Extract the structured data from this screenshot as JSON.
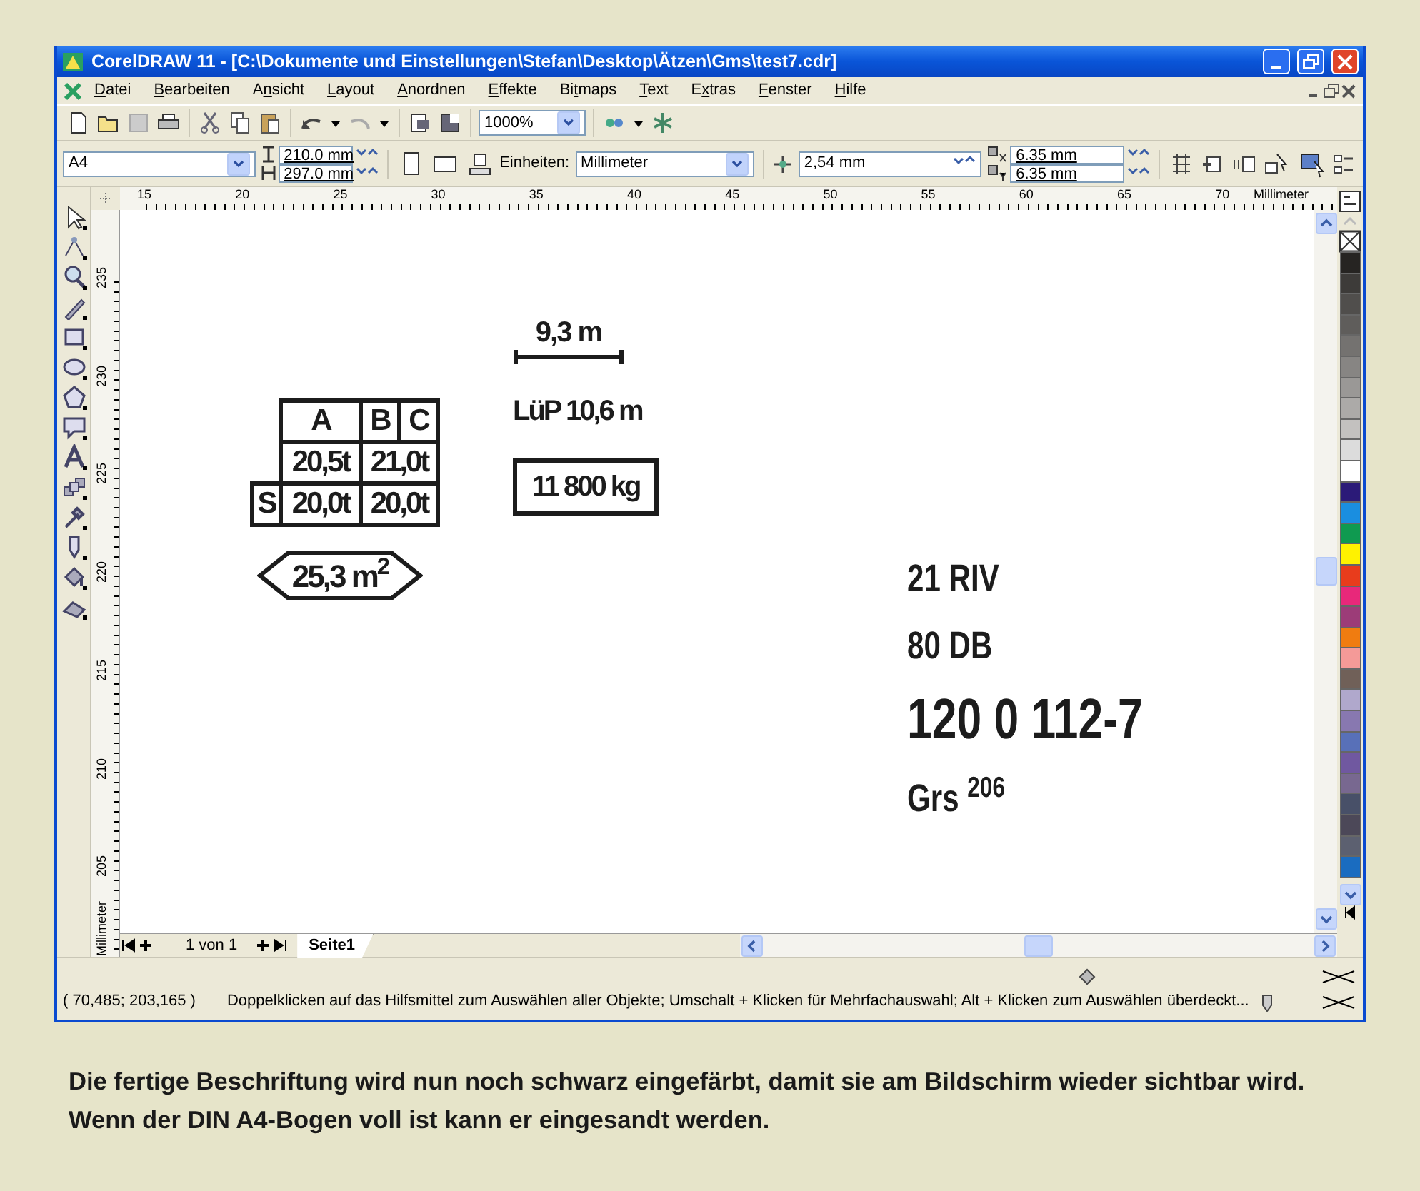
{
  "window": {
    "title": "CorelDRAW 11 - [C:\\Dokumente und Einstellungen\\Stefan\\Desktop\\Ätzen\\Gms\\test7.cdr]"
  },
  "menu": [
    {
      "key": "D",
      "post": "atei"
    },
    {
      "key": "B",
      "post": "earbeiten"
    },
    {
      "pre": "A",
      "key": "n",
      "post": "sicht"
    },
    {
      "key": "L",
      "post": "ayout"
    },
    {
      "key": "A",
      "post": "nordnen"
    },
    {
      "key": "E",
      "post": "ffekte"
    },
    {
      "pre": "Bi",
      "key": "t",
      "post": "maps"
    },
    {
      "key": "T",
      "post": "ext"
    },
    {
      "pre": "E",
      "key": "x",
      "post": "tras"
    },
    {
      "key": "F",
      "post": "enster"
    },
    {
      "key": "H",
      "post": "ilfe"
    }
  ],
  "toolbar": {
    "zoom": "1000%"
  },
  "property_bar": {
    "page_size": "A4",
    "width": "210.0 mm",
    "height": "297.0 mm",
    "units_label": "Einheiten:",
    "units": "Millimeter",
    "nudge": "2,54 mm",
    "duplicate_x": "6.35 mm",
    "duplicate_y": "6.35 mm"
  },
  "rulers": {
    "horizontal": [
      "15",
      "20",
      "25",
      "30",
      "35",
      "40",
      "45",
      "50",
      "55",
      "60",
      "65",
      "70"
    ],
    "horizontal_unit": "Millimeter",
    "vertical": [
      "235",
      "230",
      "225",
      "220",
      "215",
      "210",
      "205"
    ],
    "vertical_unit": "Millimeter"
  },
  "drawing": {
    "weight_table": {
      "columns": [
        "A",
        "B",
        "C"
      ],
      "rows": [
        {
          "cells": [
            {
              "text": "20,5t"
            },
            {
              "text": "21,0t",
              "colspan": 2
            }
          ]
        },
        {
          "label": "S",
          "cells": [
            {
              "text": "20,0t"
            },
            {
              "text": "20,0t",
              "colspan": 2
            }
          ]
        }
      ]
    },
    "area_sign": "25,3 m$^{2}$",
    "length_marker": "9,3 m",
    "overall_length": "LüP 10,6 m",
    "tare_box": "11 800 kg",
    "markings": [
      {
        "text": "21 RIV",
        "kind": "medium"
      },
      {
        "text": "80 DB",
        "kind": "medium"
      },
      {
        "text": "120 0 112-7",
        "kind": "large"
      },
      {
        "text": "Grs $^{206}$",
        "kind": "medium"
      }
    ]
  },
  "palette": [
    {
      "color": "#262422"
    },
    {
      "color": "#3d3b39"
    },
    {
      "color": "#504e4c"
    },
    {
      "color": "#5f5d5b"
    },
    {
      "color": "#747270"
    },
    {
      "color": "#878583"
    },
    {
      "color": "#9a9896"
    },
    {
      "color": "#acaaa8"
    },
    {
      "color": "#c3c1bf"
    },
    {
      "color": "#dcdcdc"
    },
    {
      "color": "#ffffff"
    },
    {
      "color": "#2b1a78"
    },
    {
      "color": "#1a8ee0"
    },
    {
      "color": "#0f9a50"
    },
    {
      "color": "#fff200"
    },
    {
      "color": "#e83c1c"
    },
    {
      "color": "#e8287a"
    },
    {
      "color": "#9c3c78"
    },
    {
      "color": "#f07c10"
    },
    {
      "color": "#f49a98"
    },
    {
      "color": "#706058"
    },
    {
      "color": "#b0a8cc"
    },
    {
      "color": "#8878b0"
    },
    {
      "color": "#5870b8"
    },
    {
      "color": "#7058a0"
    },
    {
      "color": "#786890"
    },
    {
      "color": "#485068"
    },
    {
      "color": "#4c4858"
    },
    {
      "color": "#5c6070"
    },
    {
      "color": "#1a6cc0"
    }
  ],
  "page_tabs": {
    "counter": "1 von 1",
    "tabs": [
      {
        "label": "Seite1",
        "selected": true
      }
    ]
  },
  "status_bar": {
    "coordinates": "( 70,485; 203,165 )",
    "hint": "Doppelklicken auf das Hilfsmittel zum Auswählen aller Objekte; Umschalt + Klicken für Mehrfachauswahl; Alt + Klicken zum Auswählen überdeckt..."
  },
  "caption": "Die fertige Beschriftung wird nun noch schwarz eingefärbt, damit sie am Bildschirm wieder sichtbar wird. Wenn der DIN A4-Bogen voll ist kann er eingesandt werden."
}
